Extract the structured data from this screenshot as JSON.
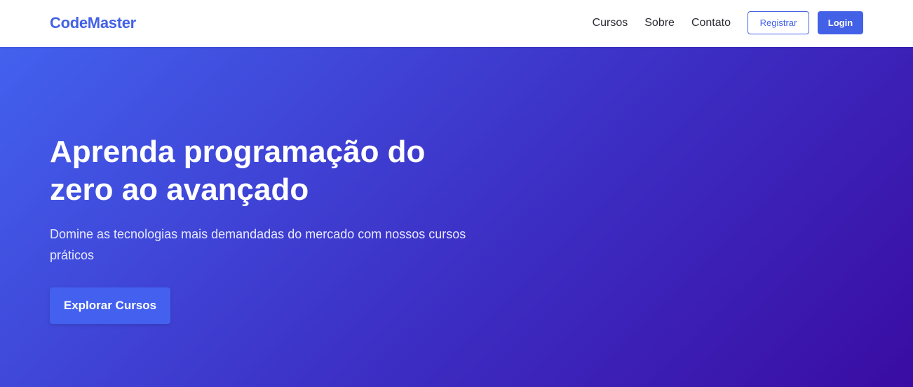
{
  "header": {
    "logo": "CodeMaster",
    "nav": {
      "cursos": "Cursos",
      "sobre": "Sobre",
      "contato": "Contato"
    },
    "register_label": "Registrar",
    "login_label": "Login"
  },
  "hero": {
    "title": "Aprenda programação do zero ao avançado",
    "subtitle": "Domine as tecnologias mais demandadas do mercado com nossos cursos práticos",
    "cta_label": "Explorar Cursos"
  },
  "colors": {
    "brand": "#4361e6",
    "hero_gradient_start": "#4361ee",
    "hero_gradient_end": "#3a0ca3",
    "text_dark": "#2b2b33",
    "white": "#ffffff"
  }
}
